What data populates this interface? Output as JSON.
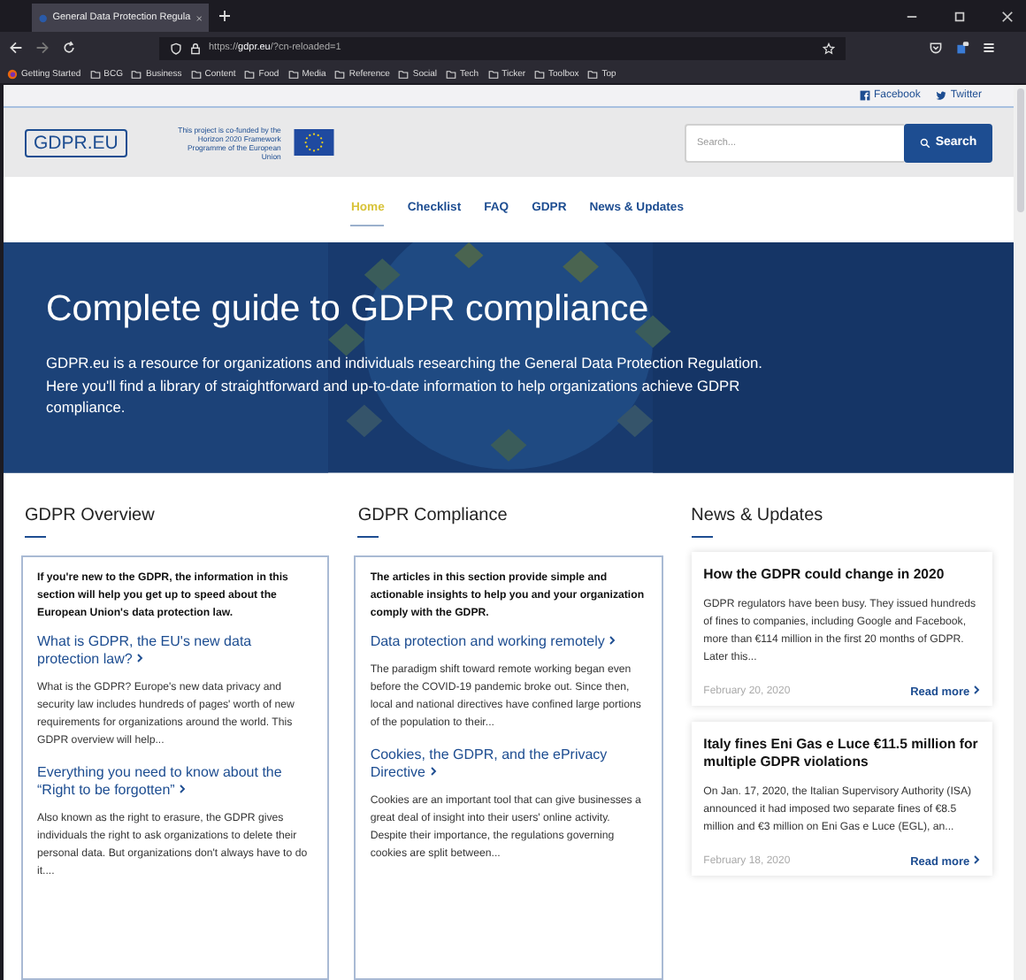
{
  "browser": {
    "tab_title": "General Data Protection Regula",
    "url_prefix": "https://",
    "url_host": "gdpr.eu",
    "url_rest": "/?cn-reloaded=1",
    "bookmarks": [
      {
        "label": "Getting Started",
        "kind": "site"
      },
      {
        "label": "BCG",
        "kind": "folder"
      },
      {
        "label": "Business",
        "kind": "folder"
      },
      {
        "label": "Content",
        "kind": "folder"
      },
      {
        "label": "Food",
        "kind": "folder"
      },
      {
        "label": "Media",
        "kind": "folder"
      },
      {
        "label": "Reference",
        "kind": "folder"
      },
      {
        "label": "Social",
        "kind": "folder"
      },
      {
        "label": "Tech",
        "kind": "folder"
      },
      {
        "label": "Ticker",
        "kind": "folder"
      },
      {
        "label": "Toolbox",
        "kind": "folder"
      },
      {
        "label": "Top",
        "kind": "folder"
      }
    ]
  },
  "social_links": [
    {
      "label": "Facebook",
      "kind": "facebook"
    },
    {
      "label": "Twitter",
      "kind": "twitter"
    }
  ],
  "header": {
    "logo": "**GDPR.**EU",
    "funding_note": "This project is co-funded by the Horizon 2020 Framework Programme of the European Union",
    "search": {
      "placeholder": "Search...",
      "button": "Search"
    }
  },
  "nav": [
    {
      "label": "Home",
      "selected": true
    },
    {
      "label": "Checklist",
      "selected": false
    },
    {
      "label": "FAQ",
      "selected": false
    },
    {
      "label": "GDPR",
      "selected": false
    },
    {
      "label": "News & Updates",
      "selected": false
    }
  ],
  "hero": {
    "title": "Complete guide to GDPR compliance",
    "text": "GDPR.eu is a resource for organizations and individuals researching the General Data Protection Regulation. Here you'll find a library of straightforward and up-to-date information to help organizations achieve GDPR compliance."
  },
  "sections": [
    {
      "title": "GDPR Overview",
      "intro": "If you're new to the GDPR, the information in this section will help you get up to speed about the European Union's data protection law.",
      "articles": [
        {
          "title": "What is GDPR, the EU's new data protection law?",
          "summary": "What is the GDPR? Europe's new data privacy and security law includes hundreds of pages' worth of new requirements for organizations around the world. This GDPR overview will help..."
        },
        {
          "title": "Everything you need to know about the “Right to be forgotten”",
          "summary": "Also known as the right to erasure, the GDPR gives individuals the right to ask organizations to delete their personal data. But organizations don't always have to do it...."
        }
      ]
    },
    {
      "title": "GDPR Compliance",
      "intro": "The articles in this section provide simple and actionable insights to help you and your organization comply with the GDPR.",
      "articles": [
        {
          "title": "Data protection and working remotely",
          "summary": "The paradigm shift toward remote working began even before the COVID-19 pandemic broke out. Since then, local and national directives have confined large portions of the population to their..."
        },
        {
          "title": "Cookies, the GDPR, and the ePrivacy Directive",
          "summary": "Cookies are an important tool that can give businesses a great deal of insight into their users' online activity. Despite their importance, the regulations governing cookies are split between..."
        }
      ]
    }
  ],
  "news": {
    "title": "News & Updates",
    "items": [
      {
        "title": "How the GDPR could change in 2020",
        "summary": "GDPR regulators have been busy. They issued hundreds of fines to companies, including Google and Facebook, more than €114 million in the first 20 months of GDPR. Later this...",
        "date": "February 20, 2020",
        "link": "Read more"
      },
      {
        "title": "Italy fines Eni Gas e Luce €11.5 million for multiple GDPR violations",
        "summary": "On Jan. 17, 2020, the Italian Supervisory Authority (ISA) announced it had imposed two separate fines of €8.5 million and €3 million on Eni Gas e Luce (EGL), an...",
        "date": "February 18, 2020",
        "link": "Read more"
      }
    ]
  }
}
